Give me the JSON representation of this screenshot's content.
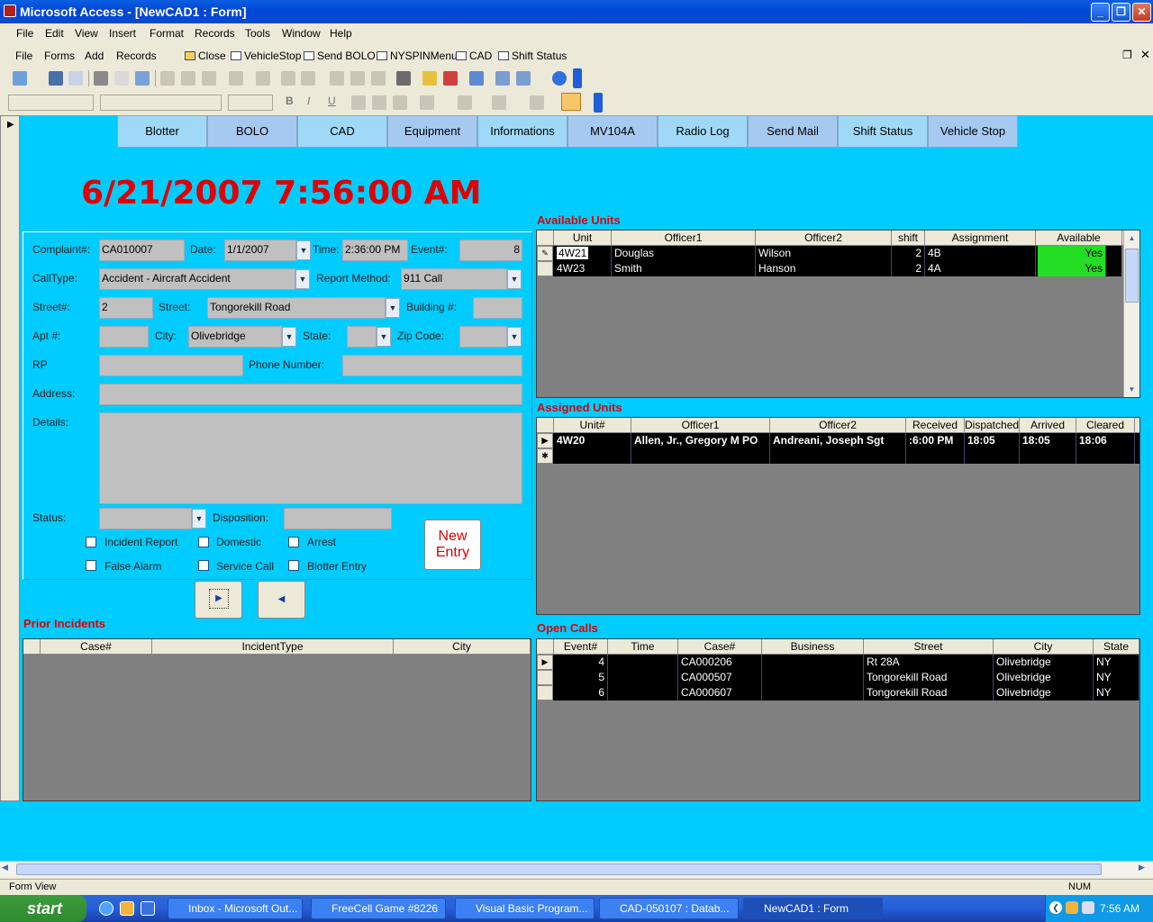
{
  "window": {
    "title": "Microsoft Access - [NewCAD1 : Form]"
  },
  "menu": [
    "File",
    "Edit",
    "View",
    "Insert",
    "Format",
    "Records",
    "Tools",
    "Window",
    "Help"
  ],
  "custom_toolbar": [
    "File",
    "Forms",
    "Add",
    "Records",
    "Close",
    "VehicleStop",
    "Send BOLO",
    "NYSPINMenu",
    "CAD",
    "Shift Status"
  ],
  "nav_buttons": [
    "Blotter",
    "BOLO",
    "CAD",
    "Equipment",
    "Informations",
    "MV104A",
    "Radio Log",
    "Send Mail",
    "Shift Status",
    "Vehicle Stop"
  ],
  "datetime": "6/21/2007 7:56:00 AM",
  "form": {
    "complaint_label": "Complaint#:",
    "complaint": "CA010007",
    "date_label": "Date:",
    "date": "1/1/2007",
    "time_label": "Time:",
    "time": "2:36:00 PM",
    "event_label": "Event#:",
    "event": "8",
    "calltype_label": "CallType:",
    "calltype": "Accident - Aircraft Accident",
    "report_method_label": "Report Method:",
    "report_method": "911 Call",
    "streetno_label": "Street#:",
    "streetno": "2",
    "street_label": "Street:",
    "street": "Tongorekill Road",
    "building_label": "Building #:",
    "building": "",
    "apt_label": "Apt #:",
    "apt": "",
    "city_label": "City:",
    "city": "Olivebridge",
    "state_label": "State:",
    "state": "",
    "zip_label": "Zip Code:",
    "zip": "",
    "rp_label": "RP",
    "rp": "",
    "phone_label": "Phone Number:",
    "phone": "",
    "address_label": "Address:",
    "address": "",
    "details_label": "Details:",
    "details": "",
    "status_label": "Status:",
    "status": "",
    "disposition_label": "Disposition:",
    "disposition": "",
    "checkboxes": [
      "Incident Report",
      "Domestic",
      "Arrest",
      "False Alarm",
      "Service Call",
      "Blotter Entry"
    ],
    "new_entry": "New Entry"
  },
  "sections": {
    "available": "Available Units",
    "assigned": "Assigned Units",
    "prior": "Prior Incidents",
    "open": "Open Calls"
  },
  "available_units": {
    "columns": [
      "Unit",
      "Officer1",
      "Officer2",
      "shift",
      "Assignment",
      "Available"
    ],
    "rows": [
      [
        "4W21",
        "Douglas",
        "Wilson",
        "2",
        "4B",
        "Yes"
      ],
      [
        "4W23",
        "Smith",
        "Hanson",
        "2",
        "4A",
        "Yes"
      ]
    ]
  },
  "assigned_units": {
    "columns": [
      "Unit#",
      "Officer1",
      "Officer2",
      "Received",
      "Dispatched",
      "Arrived",
      "Cleared"
    ],
    "rows": [
      [
        "4W20",
        "Allen, Jr., Gregory M PO",
        "Andreani, Joseph Sgt",
        ":6:00 PM",
        "18:05",
        "18:05",
        "18:06"
      ]
    ]
  },
  "prior_incidents": {
    "columns": [
      "Case#",
      "IncidentType",
      "City"
    ]
  },
  "open_calls": {
    "columns": [
      "Event#",
      "Time",
      "Case#",
      "Business",
      "Street",
      "City",
      "State"
    ],
    "rows": [
      [
        "4",
        "",
        "CA000206",
        "",
        "Rt 28A",
        "Olivebridge",
        "NY"
      ],
      [
        "5",
        "",
        "CA000507",
        "",
        "Tongorekill Road",
        "Olivebridge",
        "NY"
      ],
      [
        "6",
        "",
        "CA000607",
        "",
        "Tongorekill Road",
        "Olivebridge",
        "NY"
      ]
    ]
  },
  "status": {
    "view": "Form View",
    "num": "NUM"
  },
  "taskbar": {
    "start": "start",
    "tasks": [
      "Inbox - Microsoft Out...",
      "FreeCell Game #8226",
      "Visual Basic Program...",
      "CAD-050107 : Datab...",
      "NewCAD1 : Form"
    ],
    "clock": "7:56 AM"
  },
  "colors": {
    "background": "#00ccff",
    "alert": "#e00000",
    "available": "#22dd22"
  }
}
